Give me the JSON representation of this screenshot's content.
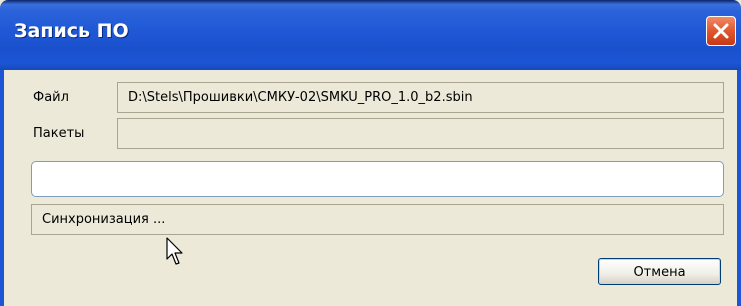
{
  "window": {
    "title": "Запись ПО",
    "close_icon": "close-x-icon"
  },
  "form": {
    "file_label": "Файл",
    "file_value": "D:\\Stels\\Прошивки\\СМКУ-02\\SMKU_PRO_1.0_b2.sbin",
    "packets_label": "Пакеты",
    "packets_value": "",
    "progress_fraction": 0,
    "status_text": "Синхронизация ..."
  },
  "buttons": {
    "cancel_label": "Отмена"
  },
  "colors": {
    "dialog_bg": "#ECE9D8",
    "title_bar": "#1F58D6",
    "close_button": "#E0562E",
    "progress_fill": "#3C9B2B"
  }
}
